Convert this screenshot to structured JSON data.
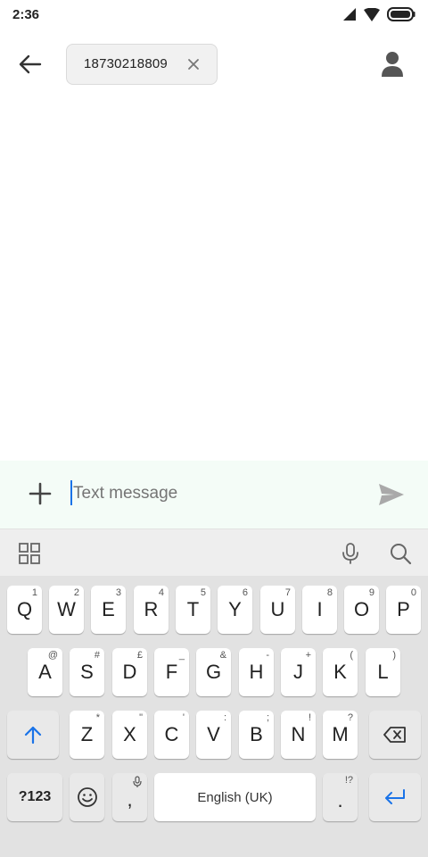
{
  "status_bar": {
    "time": "2:36"
  },
  "app_bar": {
    "recipient": "18730218809"
  },
  "compose": {
    "placeholder": "Text message"
  },
  "keyboard": {
    "row1": [
      {
        "label": "Q",
        "hint": "1"
      },
      {
        "label": "W",
        "hint": "2"
      },
      {
        "label": "E",
        "hint": "3"
      },
      {
        "label": "R",
        "hint": "4"
      },
      {
        "label": "T",
        "hint": "5"
      },
      {
        "label": "Y",
        "hint": "6"
      },
      {
        "label": "U",
        "hint": "7"
      },
      {
        "label": "I",
        "hint": "8"
      },
      {
        "label": "O",
        "hint": "9"
      },
      {
        "label": "P",
        "hint": "0"
      }
    ],
    "row2": [
      {
        "label": "A",
        "hint": "@"
      },
      {
        "label": "S",
        "hint": "#"
      },
      {
        "label": "D",
        "hint": "£"
      },
      {
        "label": "F",
        "hint": "_"
      },
      {
        "label": "G",
        "hint": "&"
      },
      {
        "label": "H",
        "hint": "-"
      },
      {
        "label": "J",
        "hint": "+"
      },
      {
        "label": "K",
        "hint": "("
      },
      {
        "label": "L",
        "hint": ")"
      }
    ],
    "row3": [
      {
        "label": "Z",
        "hint": "*"
      },
      {
        "label": "X",
        "hint": "\""
      },
      {
        "label": "C",
        "hint": "'"
      },
      {
        "label": "V",
        "hint": ":"
      },
      {
        "label": "B",
        "hint": ";"
      },
      {
        "label": "N",
        "hint": "!"
      },
      {
        "label": "M",
        "hint": "?"
      }
    ],
    "symbols_label": "?123",
    "comma_label": ",",
    "space_label": "English (UK)",
    "period_label": ".",
    "period_hint": "!?"
  },
  "colors": {
    "accent": "#1a73e8",
    "compose_bg": "#f4fcf7",
    "keyboard_bg": "#e2e2e2"
  }
}
